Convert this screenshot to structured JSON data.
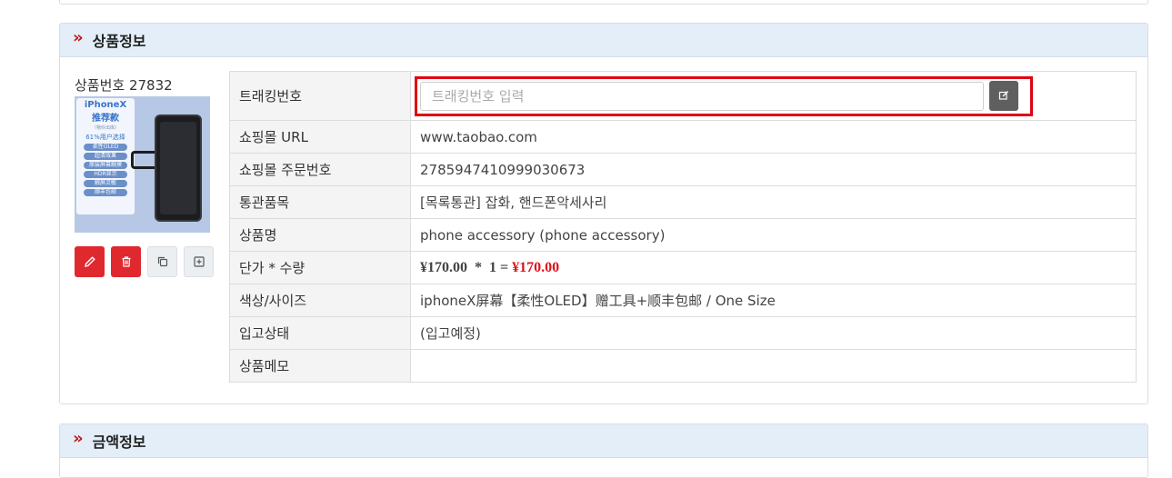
{
  "product_section": {
    "title": "상품정보",
    "product_number_label": "상품번호 27832",
    "thumbnail": {
      "line1": "iPhoneX",
      "line2": "推荐款",
      "line3": "（物伶出库）",
      "line4": "61%用户选择",
      "pills": [
        "柔性OLED",
        "超清效果",
        "原装屏幕触摸",
        "HDR显示",
        "触屏灵敏",
        "顺丰包邮"
      ]
    },
    "action_icons": [
      "edit-icon",
      "trash-icon",
      "copy-icon",
      "plus-square-icon"
    ]
  },
  "details": {
    "tracking": {
      "label": "트래킹번호",
      "value": "",
      "placeholder": "트래킹번호 입력"
    },
    "mall_url": {
      "label": "쇼핑몰 URL",
      "value": "www.taobao.com"
    },
    "order_no": {
      "label": "쇼핑몰 주문번호",
      "value": "2785947410999030673"
    },
    "customs": {
      "label": "통관품목",
      "value": "[목록통관] 잡화, 핸드폰악세사리"
    },
    "product_name": {
      "label": "상품명",
      "value": "phone accessory (phone accessory)"
    },
    "price_qty": {
      "label": "단가 * 수량",
      "unit_price": "¥170.00",
      "times": "*",
      "qty": "1",
      "equals": "=",
      "total": "¥170.00"
    },
    "color_size": {
      "label": "색상/사이즈",
      "value": "iphoneX屏幕【柔性OLED】赠工具+顺丰包邮 / One Size"
    },
    "stock_status": {
      "label": "입고상태",
      "value": "(입고예정)"
    },
    "memo": {
      "label": "상품메모",
      "value": ""
    }
  },
  "amount_section": {
    "title": "금액정보"
  },
  "colors": {
    "accent_red": "#e0282f",
    "header_bg": "#e3eef8",
    "highlight_outline": "#e00014"
  }
}
